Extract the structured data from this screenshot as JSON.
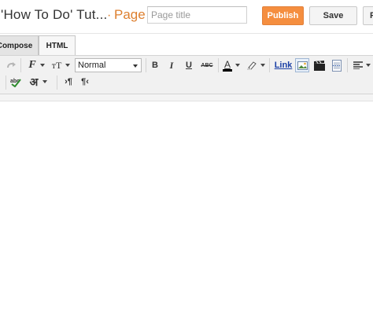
{
  "header": {
    "blog_title": "'How To Do' Tut...",
    "separator": "·",
    "page_label": "Page",
    "title_input": {
      "placeholder": "Page title",
      "value": ""
    },
    "publish_label": "Publish",
    "save_label": "Save",
    "extra_label": "P"
  },
  "tabs": [
    {
      "label": "Compose",
      "active": true
    },
    {
      "label": "HTML",
      "active": false
    }
  ],
  "toolbar": {
    "format_select": "Normal",
    "bold": "B",
    "italic": "I",
    "underline": "U",
    "strike": "ABC",
    "font_color": "A",
    "link": "Link",
    "hindi": "अ",
    "font_family": "F",
    "font_size": "тT"
  },
  "colors": {
    "accent": "#dd7f2e",
    "publish_bg": "#f58e3f",
    "link": "#1a3fa5",
    "toolbar_bg": "#f1f1f1"
  }
}
